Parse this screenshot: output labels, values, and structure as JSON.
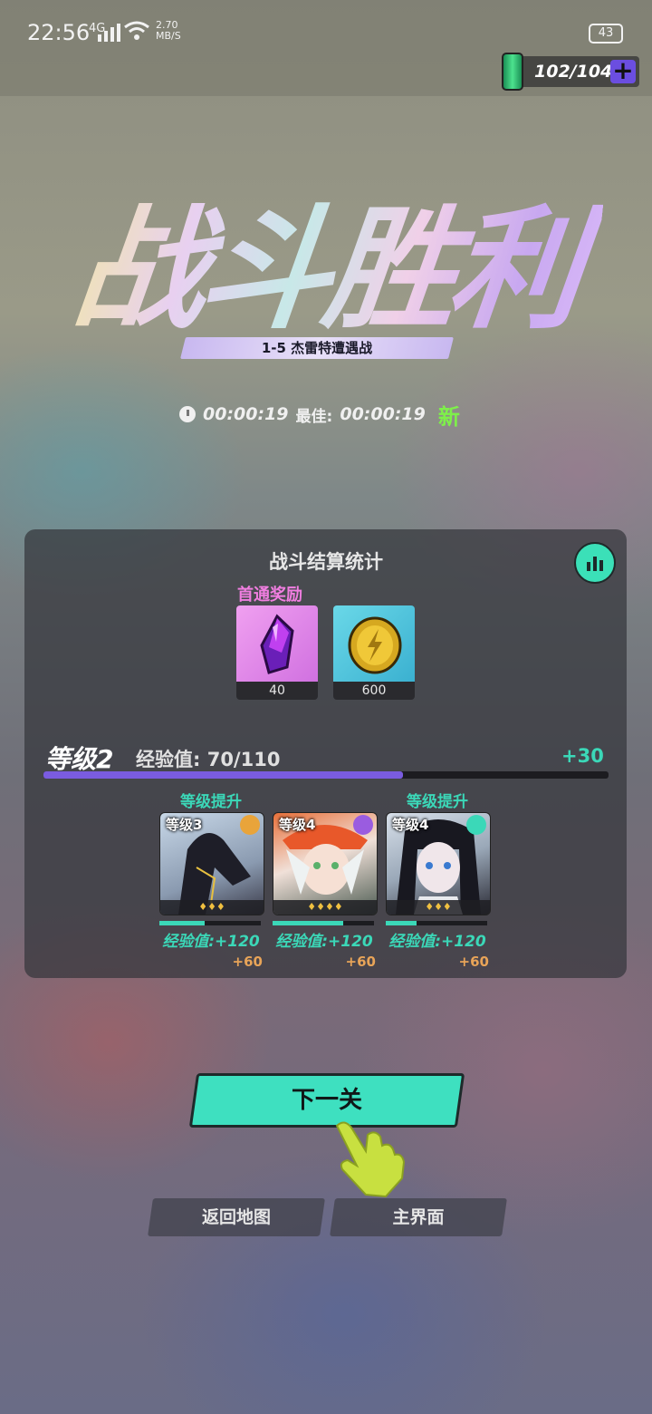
{
  "status": {
    "time": "22:56",
    "network": "4G",
    "speed_value": "2.70",
    "speed_unit": "MB/S",
    "battery": "43"
  },
  "energy": {
    "value": "102/104"
  },
  "result": {
    "title": "战斗胜利",
    "stage": "1-5  杰雷特遭遇战",
    "time": "00:00:19",
    "best_label": "最佳:",
    "best_time": "00:00:19",
    "new_badge": "新"
  },
  "panel": {
    "title": "战斗结算统计",
    "first_clear_label": "首通奖励",
    "rewards": [
      {
        "item": "purple-crystal",
        "count": "40"
      },
      {
        "item": "gold-coin",
        "count": "600"
      }
    ],
    "level": "等级2",
    "exp_label": "经验值: 70/110",
    "exp_progress": 0.636,
    "exp_gain": "+30"
  },
  "heroes": [
    {
      "level_up": "等级提升",
      "level": "等级3",
      "element": "orange-gear",
      "stars": "♦♦♦",
      "exp": "经验值:+120",
      "bonus": "+60",
      "exp_progress": 0.45,
      "accent": "#e9a43a"
    },
    {
      "level_up": "",
      "level": "等级4",
      "element": "purple-lightbulb",
      "stars": "♦♦♦♦",
      "exp": "经验值:+120",
      "bonus": "+60",
      "exp_progress": 0.7,
      "accent": "#9a5ce0"
    },
    {
      "level_up": "等级提升",
      "level": "等级4",
      "element": "teal-swirl",
      "stars": "♦♦♦",
      "exp": "经验值:+120",
      "bonus": "+60",
      "exp_progress": 0.3,
      "accent": "#3bd8b8"
    }
  ],
  "buttons": {
    "next": "下一关",
    "back_to_map": "返回地图",
    "main_menu": "主界面"
  },
  "colors": {
    "accent_teal": "#3ee0c0",
    "exp_purple": "#7a5ce0",
    "reward_pink": "#f07ee0",
    "bonus_orange": "#e8a458",
    "new_green": "#7ef04a"
  }
}
